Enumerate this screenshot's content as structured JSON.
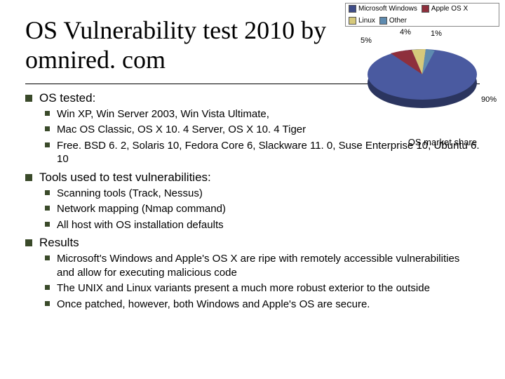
{
  "title": "OS Vulnerability test 2010 by omnired. com",
  "chart_caption": "OS market share",
  "chart_data": {
    "type": "pie",
    "title": "OS market share",
    "legend": [
      "Microsoft Windows",
      "Apple OS X",
      "Linux",
      "Other"
    ],
    "categories": [
      "Microsoft Windows",
      "Apple OS X",
      "Linux",
      "Other"
    ],
    "values": [
      90,
      5,
      4,
      1
    ],
    "labels_shown": [
      "5%",
      "4%",
      "1%",
      "90%"
    ],
    "colors": [
      "#3E4C88",
      "#8E2F3C",
      "#D6C97B",
      "#5E8BB0"
    ]
  },
  "sections": [
    {
      "label": "OS tested:",
      "items": [
        "Win XP, Win Server 2003, Win Vista Ultimate,",
        "Mac OS Classic, OS X 10. 4 Server, OS X 10. 4 Tiger",
        "Free. BSD 6. 2, Solaris 10, Fedora Core 6, Slackware 11. 0, Suse Enterprise 10, Ubuntu 6. 10"
      ]
    },
    {
      "label": "Tools used to test vulnerabilities:",
      "items": [
        "Scanning tools (Track, Nessus)",
        "Network mapping (Nmap command)",
        "All host with OS installation defaults"
      ]
    },
    {
      "label": "Results",
      "items": [
        "Microsoft's Windows and Apple's OS X are ripe with remotely accessible vulnerabilities and allow for executing malicious code",
        "The UNIX and Linux variants present a much more robust exterior to the outside",
        "Once patched, however, both Windows and Apple's OS are secure."
      ]
    }
  ]
}
